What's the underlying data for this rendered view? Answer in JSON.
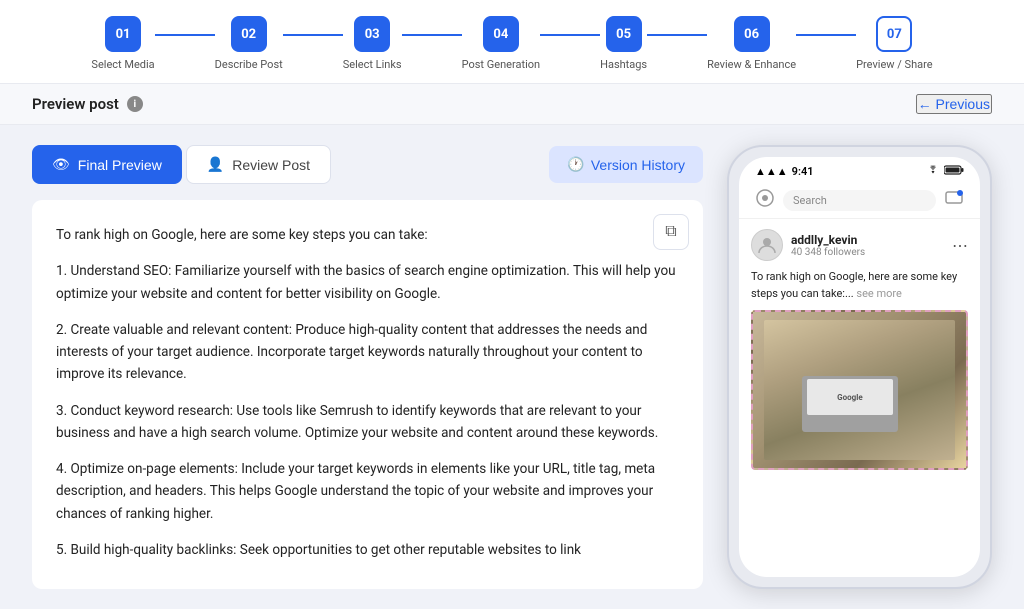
{
  "stepper": {
    "steps": [
      {
        "number": "01",
        "label": "Select Media",
        "active": false
      },
      {
        "number": "02",
        "label": "Describe Post",
        "active": false
      },
      {
        "number": "03",
        "label": "Select Links",
        "active": false
      },
      {
        "number": "04",
        "label": "Post Generation",
        "active": false
      },
      {
        "number": "05",
        "label": "Hashtags",
        "active": false
      },
      {
        "number": "06",
        "label": "Review & Enhance",
        "active": false
      },
      {
        "number": "07",
        "label": "Preview / Share",
        "active": true
      }
    ]
  },
  "header": {
    "preview_label": "Preview post",
    "info_icon": "i",
    "previous_label": "← Previous"
  },
  "tabs": {
    "final_preview_label": "Final Preview",
    "review_post_label": "Review Post",
    "version_history_label": "Version History"
  },
  "icons": {
    "eye_icon": "👁",
    "user_icon": "👤",
    "copy_icon": "⧉",
    "clock_icon": "🕐",
    "signal_icon": "▲",
    "wifi_icon": "◈",
    "battery_icon": "▬"
  },
  "post_content": {
    "paragraph1": "To rank high on Google, here are some key steps you can take:",
    "paragraph2": "1. Understand SEO: Familiarize yourself with the basics of search engine optimization. This will help you optimize your website and content for better visibility on Google.",
    "paragraph3": "2. Create valuable and relevant content: Produce high-quality content that addresses the needs and interests of your target audience. Incorporate target keywords naturally throughout your content to improve its relevance.",
    "paragraph4": "3. Conduct keyword research: Use tools like Semrush to identify keywords that are relevant to your business and have a high search volume. Optimize your website and content around these keywords.",
    "paragraph5": "4. Optimize on-page elements: Include your target keywords in elements like your URL, title tag, meta description, and headers. This helps Google understand the topic of your website and improves your chances of ranking higher.",
    "paragraph6": "5. Build high-quality backlinks: Seek opportunities to get other reputable websites to link"
  },
  "phone": {
    "time": "9:41",
    "username": "addlly_kevin",
    "followers": "40 348 followers",
    "caption": "To rank high on Google, here are some key steps you can take:...",
    "see_more": "see more",
    "search_placeholder": "Search",
    "google_text": "Google"
  }
}
